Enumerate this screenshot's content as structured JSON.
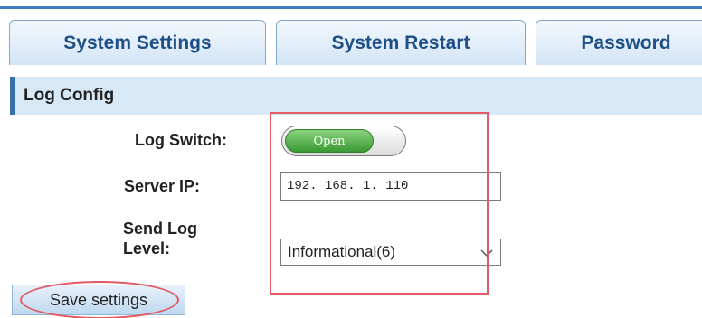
{
  "tabs": [
    {
      "label": "System Settings"
    },
    {
      "label": "System Restart"
    },
    {
      "label": "Password"
    }
  ],
  "section": {
    "title": "Log Config"
  },
  "form": {
    "log_switch": {
      "label": "Log Switch:",
      "state": "Open"
    },
    "server_ip": {
      "label": "Server IP:",
      "value": "192. 168. 1. 110"
    },
    "send_log_level": {
      "label_line1": "Send Log",
      "label_line2": "Level:",
      "selected": "Informational(6)"
    }
  },
  "actions": {
    "save_label": "Save settings"
  },
  "colors": {
    "accent": "#3d7fc1",
    "tab_text": "#1e4f86",
    "switch_on": "#3a9a35",
    "highlight": "#e25a62"
  },
  "icons": {
    "select_arrow": "chevron-down-icon"
  }
}
